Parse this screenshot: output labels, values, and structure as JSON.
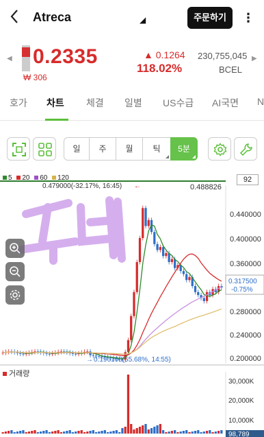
{
  "header": {
    "stock_name": "Atreca",
    "order_button": "주문하기"
  },
  "price": {
    "current": "0.2335",
    "prev_won": "₩ 306",
    "change": "0.1264",
    "change_pct": "118.02%",
    "volume": "230,755,045",
    "market": "BCEL"
  },
  "tabs": [
    "호가",
    "차트",
    "체결",
    "일별",
    "US수급",
    "AI국면",
    "N"
  ],
  "active_tab": "차트",
  "periods": [
    "일",
    "주",
    "월",
    "틱",
    "5분"
  ],
  "selected_period": "5분",
  "chart": {
    "ma_legend": [
      {
        "label": "5",
        "color": "#2e8b2e"
      },
      {
        "label": "20",
        "color": "#d72b2b"
      },
      {
        "label": "60",
        "color": "#a050c8"
      },
      {
        "label": "120",
        "color": "#d8b24a"
      }
    ],
    "count": "92",
    "high_annotation": "0.479000(-32.17%, 16:45)",
    "low_annotation": "0.196100(65.68%, 14:55)",
    "top_line_value": "0.488826",
    "current_label": "0.317500",
    "current_pct": "-0.75%",
    "y_ticks": [
      "0.440000",
      "0.400000",
      "0.360000",
      "0.280000",
      "0.240000",
      "0.200000"
    ],
    "volume_label": "거래량",
    "vol_ticks": [
      "30,000K",
      "20,000K",
      "10,000K"
    ],
    "vol_bottom": "98,789",
    "handwriting": "두배"
  }
}
